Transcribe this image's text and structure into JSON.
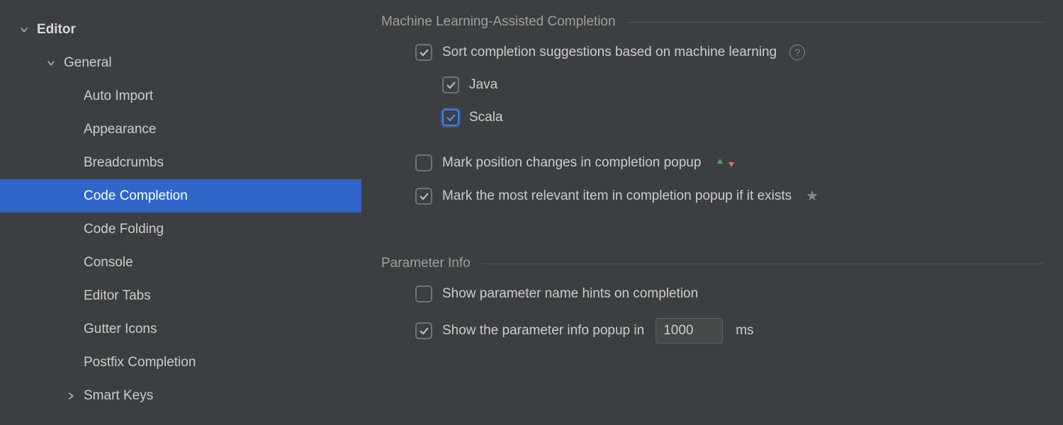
{
  "sidebar": {
    "root": {
      "label": "Editor"
    },
    "general": {
      "label": "General"
    },
    "items": [
      "Auto Import",
      "Appearance",
      "Breadcrumbs",
      "Code Completion",
      "Code Folding",
      "Console",
      "Editor Tabs",
      "Gutter Icons",
      "Postfix Completion"
    ],
    "smartKeys": {
      "label": "Smart Keys"
    }
  },
  "sections": {
    "ml": {
      "title": "Machine Learning-Assisted Completion",
      "sortLabel": "Sort completion suggestions based on machine learning",
      "javaLabel": "Java",
      "scalaLabel": "Scala",
      "markPositionLabel": "Mark position changes in completion popup",
      "markRelevantLabel": "Mark the most relevant item in completion popup if it exists"
    },
    "param": {
      "title": "Parameter Info",
      "hintsLabel": "Show parameter name hints on completion",
      "popupLabel": "Show the parameter info popup in",
      "popupValue": "1000",
      "popupUnit": "ms"
    }
  },
  "checked": {
    "sort": true,
    "java": true,
    "scala": true,
    "markPosition": false,
    "markRelevant": true,
    "hints": false,
    "popup": true
  }
}
